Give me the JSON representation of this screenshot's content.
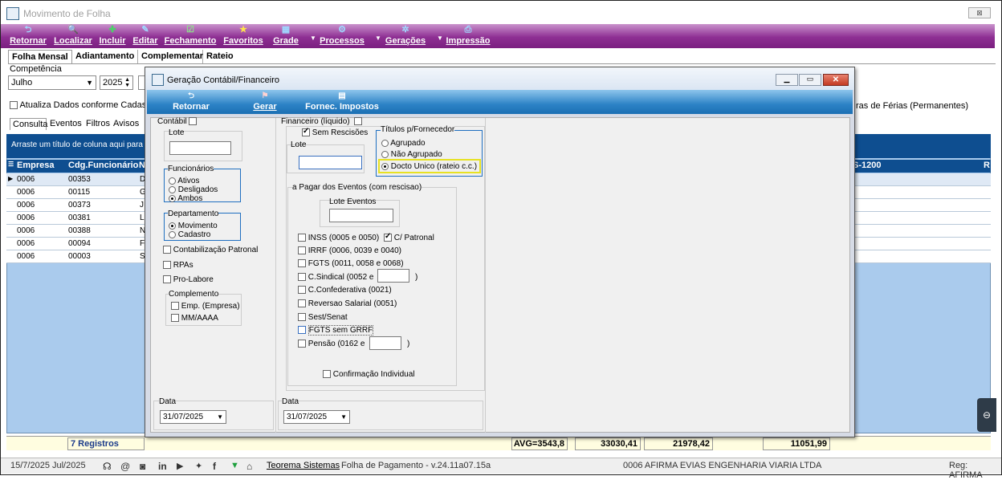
{
  "main": {
    "window_title": "Movimento de Folha",
    "close_glyph": "⊠",
    "toolbar": [
      {
        "label": "Retornar",
        "icon": "back-arrow-icon",
        "glyph": "⮌"
      },
      {
        "label": "Localizar",
        "icon": "search-icon",
        "glyph": "🔍"
      },
      {
        "label": "Incluir",
        "icon": "plus-icon",
        "glyph": "✚"
      },
      {
        "label": "Editar",
        "icon": "edit-icon",
        "glyph": "✎"
      },
      {
        "label": "Fechamento",
        "icon": "checklist-icon",
        "glyph": "☑"
      },
      {
        "label": "Favoritos",
        "icon": "star-icon",
        "glyph": "★"
      },
      {
        "label": "Grade",
        "icon": "grid-icon",
        "glyph": "▦"
      },
      {
        "label": "Processos",
        "icon": "process-icon",
        "glyph": "⚙"
      },
      {
        "label": "Gerações",
        "icon": "gear-icon",
        "glyph": "✲"
      },
      {
        "label": "Impressão",
        "icon": "printer-icon",
        "glyph": "⎙"
      }
    ],
    "tabs": [
      "Folha Mensal",
      "Adiantamento",
      "Complementar",
      "Rateio"
    ],
    "competencia_label": "Competência",
    "month": "Julho",
    "year": "2025",
    "atualiza_label": "Atualiza Dados conforme Cadastro",
    "ferias_label": "ras de Férias (Permanentes)",
    "subtabs": [
      "Consulta",
      "Eventos",
      "Filtros",
      "Avisos"
    ],
    "grid_hint": "Arraste um título de coluna aqui para c",
    "columns": {
      "empresa": "Empresa",
      "funcionario": "Cdg.Funcionário",
      "n": "N",
      "s1200": "S-1200",
      "r": "R"
    },
    "rows": [
      {
        "empresa": "0006",
        "func": "00353",
        "n": "D"
      },
      {
        "empresa": "0006",
        "func": "00115",
        "n": "G"
      },
      {
        "empresa": "0006",
        "func": "00373",
        "n": "J"
      },
      {
        "empresa": "0006",
        "func": "00381",
        "n": "L"
      },
      {
        "empresa": "0006",
        "func": "00388",
        "n": "N"
      },
      {
        "empresa": "0006",
        "func": "00094",
        "n": "F"
      },
      {
        "empresa": "0006",
        "func": "00003",
        "n": "S"
      }
    ],
    "footer": {
      "registros": "7 Registros",
      "avg": "AVG=3543,8",
      "v1": "33030,41",
      "v2": "21978,42",
      "v3": "11051,99"
    }
  },
  "status": {
    "date": "15/7/2025 Jul/2025",
    "company_link": "Teorema Sistemas",
    "app_version": "Folha de Pagamento - v.24.11a07.15a",
    "empresa": "0006 AFIRMA EVIAS ENGENHARIA VIARIA LTDA",
    "reg": "Reg: AFIRMA"
  },
  "dialog": {
    "title": "Geração Contábil/Financeiro",
    "toolbar": [
      {
        "label": "Retornar",
        "icon": "back-arrow-icon",
        "glyph": "⮌"
      },
      {
        "label": "Gerar",
        "icon": "generate-icon",
        "glyph": "⚑"
      },
      {
        "label": "Fornec. Impostos",
        "icon": "document-icon",
        "glyph": "▤"
      }
    ],
    "contabil_label": "Contábil",
    "lote_label": "Lote",
    "funcionarios_label": "Funcionários",
    "funcionarios_options": [
      "Ativos",
      "Desligados",
      "Ambos"
    ],
    "departamento_label": "Departamento",
    "departamento_options": [
      "Movimento",
      "Cadastro"
    ],
    "contab_patronal": "Contabilização Patronal",
    "rpas": "RPAs",
    "pro_labore": "Pro-Labore",
    "complemento_label": "Complemento",
    "complemento_options": [
      "Emp. (Empresa)",
      "MM/AAAA"
    ],
    "financeiro_label": "Financeiro  (líquido)",
    "sem_rescisoes": "Sem Rescisões",
    "lote2_label": "Lote",
    "titulos_label": "Títulos p/Fornecedor",
    "titulos_options": [
      "Agrupado",
      "Não Agrupado",
      "Docto Unico (rateio c.c.)"
    ],
    "apagar_label": "a Pagar dos Eventos (com rescisao)",
    "lote_eventos_label": "Lote Eventos",
    "eventos": {
      "inss": "INSS (0005 e 0050)",
      "c_patronal": "C/ Patronal",
      "irrf": "IRRF (0006, 0039 e 0040)",
      "fgts": "FGTS (0011, 0058 e 0068)",
      "csindical": "C.Sindical (0052 e",
      "close_paren": ")",
      "cconfed": "C.Confederativa (0021)",
      "reversao": "Reversao Salarial (0051)",
      "sest": "Sest/Senat",
      "fgts_grrf": "FGTS sem GRRF",
      "pensao": "Pensão (0162 e",
      "confirmacao": "Confirmação Individual"
    },
    "data_label": "Data",
    "data_value": "31/07/2025",
    "data_label2": "Data",
    "data_value2": "31/07/2025"
  }
}
